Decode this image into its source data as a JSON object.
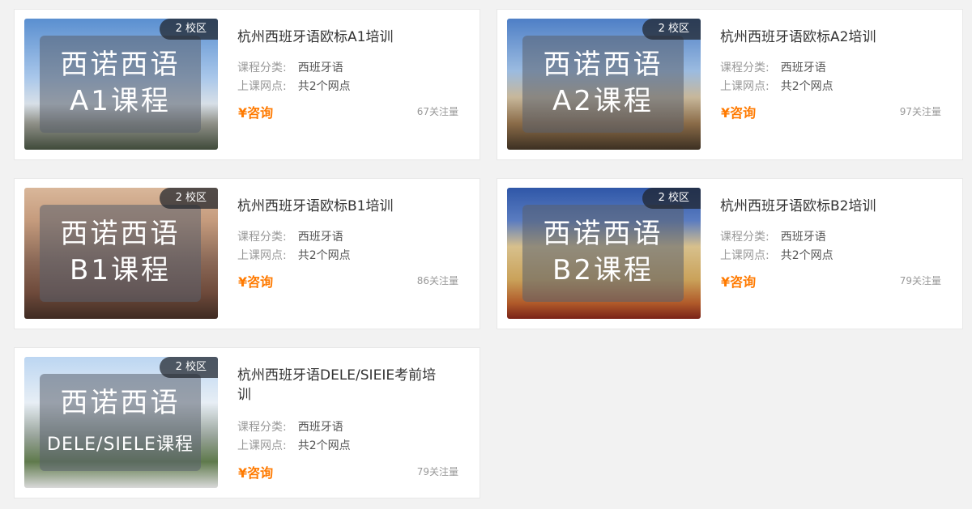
{
  "cards": [
    {
      "badge": "2 校区",
      "overlay_line1": "西诺西语",
      "overlay_line2": "A1课程",
      "title": "杭州西班牙语欧标A1培训",
      "category_label": "课程分类:",
      "category_value": "西班牙语",
      "location_label": "上课网点:",
      "location_value": "共2个网点",
      "price": "¥咨询",
      "follow": "67关注量"
    },
    {
      "badge": "2 校区",
      "overlay_line1": "西诺西语",
      "overlay_line2": "A2课程",
      "title": "杭州西班牙语欧标A2培训",
      "category_label": "课程分类:",
      "category_value": "西班牙语",
      "location_label": "上课网点:",
      "location_value": "共2个网点",
      "price": "¥咨询",
      "follow": "97关注量"
    },
    {
      "badge": "2 校区",
      "overlay_line1": "西诺西语",
      "overlay_line2": "B1课程",
      "title": "杭州西班牙语欧标B1培训",
      "category_label": "课程分类:",
      "category_value": "西班牙语",
      "location_label": "上课网点:",
      "location_value": "共2个网点",
      "price": "¥咨询",
      "follow": "86关注量"
    },
    {
      "badge": "2 校区",
      "overlay_line1": "西诺西语",
      "overlay_line2": "B2课程",
      "title": "杭州西班牙语欧标B2培训",
      "category_label": "课程分类:",
      "category_value": "西班牙语",
      "location_label": "上课网点:",
      "location_value": "共2个网点",
      "price": "¥咨询",
      "follow": "79关注量"
    },
    {
      "badge": "2 校区",
      "overlay_line1": "西诺西语",
      "overlay_line2": "DELE/SIELE课程",
      "title": "杭州西班牙语DELE/SIEIE考前培训",
      "category_label": "课程分类:",
      "category_value": "西班牙语",
      "location_label": "上课网点:",
      "location_value": "共2个网点",
      "price": "¥咨询",
      "follow": "79关注量"
    }
  ],
  "colors": {
    "price": "#ff7a00",
    "page_bg": "#f2f2f2",
    "card_bg": "#ffffff"
  }
}
